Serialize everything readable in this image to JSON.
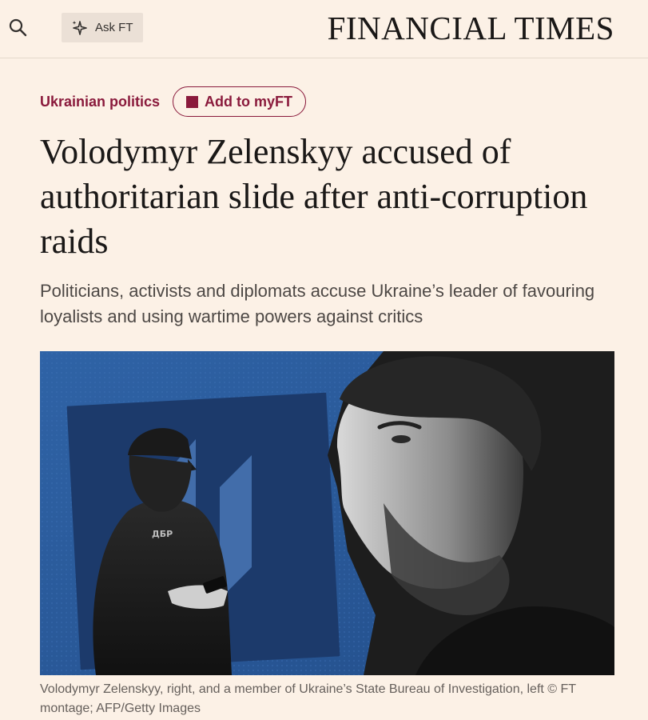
{
  "header": {
    "ask_label": "Ask FT",
    "masthead": "FINANCIAL TIMES"
  },
  "article": {
    "topic": "Ukrainian politics",
    "add_myft_label": "Add to myFT",
    "headline": "Volodymyr Zelenskyy accused of authoritarian slide after anti-corruption raids",
    "standfirst": "Politicians, activists and diplomats accuse Ukraine’s leader of favouring loyalists and using wartime powers against critics",
    "caption": "Volodymyr Zelenskyy, right, and a member of Ukraine’s State Bureau of Investigation, left © FT montage; AFP/Getty Images"
  },
  "image": {
    "badge_text": "ДБР"
  },
  "colors": {
    "page_background": "#fcf1e6",
    "brand_claret": "#8a1a3c",
    "image_blue": "#2b5a9a",
    "image_navy": "#1c3a6b"
  },
  "icons": {
    "search": "search-icon",
    "ask": "sparkle-icon",
    "myft": "square-icon"
  }
}
